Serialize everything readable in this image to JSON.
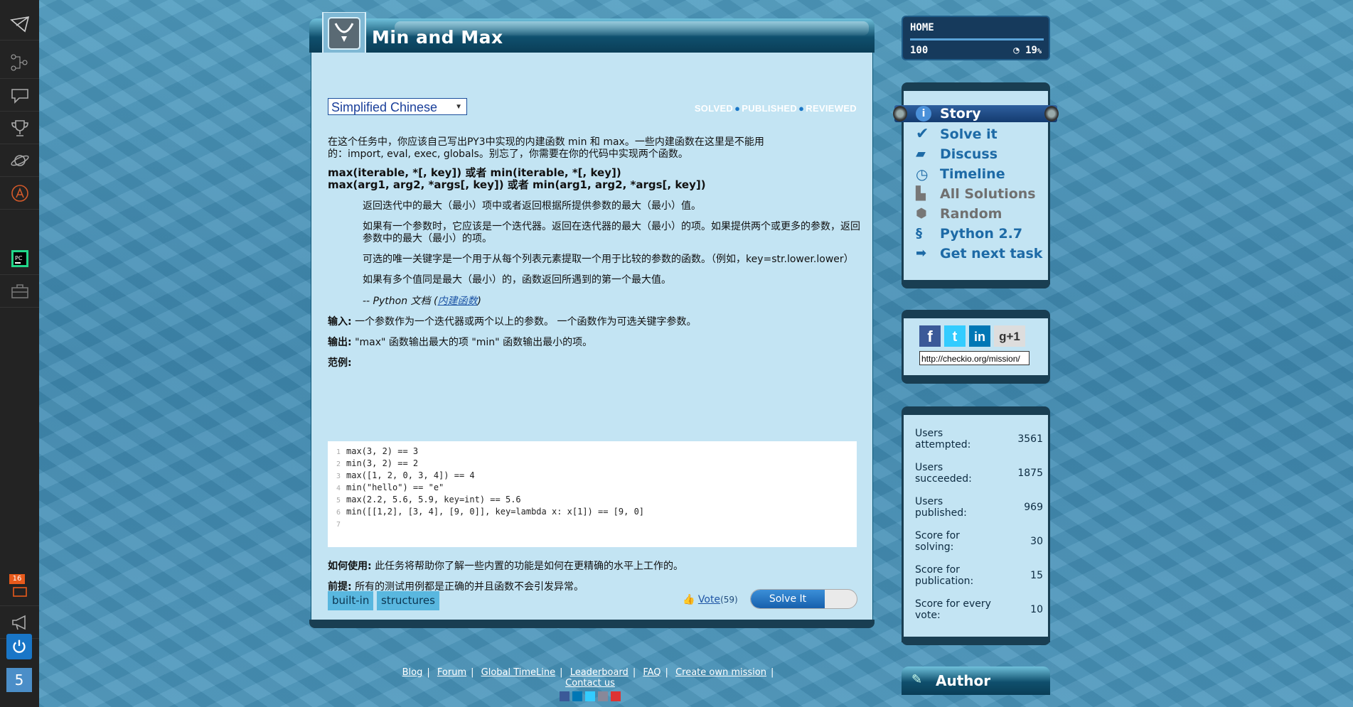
{
  "sidebar": {
    "icons": [
      "mail-icon",
      "tree-icon",
      "chat-icon",
      "trophy-icon",
      "planet-icon",
      "language-icon",
      "pycharm-icon",
      "briefcase-icon"
    ],
    "notification_count": "16",
    "level": "5"
  },
  "mission": {
    "title": "Min and Max",
    "language_selected": "Simplified Chinese",
    "status": {
      "solved": "SOLVED",
      "published": "PUBLISHED",
      "reviewed": "REVIEWED"
    },
    "intro_1": "在这个任务中，你应该自己写出PY3中实现的内建函数 min 和 max。一些内建函数在这里是不能用",
    "intro_2": "的：import, eval, exec, globals。别忘了，你需要在你的代码中实现两个函数。",
    "sig_1": "max(iterable, *[, key]) 或者 min(iterable, *[, key])",
    "sig_2": "max(arg1, arg2, *args[, key]) 或者 min(arg1, arg2, *args[, key])",
    "desc_1": "返回迭代中的最大（最小）项中或者返回根据所提供参数的最大（最小）值。",
    "desc_2a": "如果有一个参数时，它应该是一个迭代器。返回在迭代器的最大（最小）的项。如果提供两个或更多的参数，返回",
    "desc_2b": "参数中的最大（最小）的项。",
    "desc_3": "可选的唯一关键字是一个用于从每个列表元素提取一个用于比较的参数的函数。（例如，key=str.lower.lower）",
    "desc_4": "如果有多个值同是最大（最小）的，函数返回所遇到的第一个最大值。",
    "doc_prefix": "-- Python 文档 (",
    "doc_link": "内建函数",
    "doc_suffix": ")",
    "input_label": "输入:",
    "input_text": "一个参数作为一个迭代器或两个以上的参数。   一个函数作为可选关键字参数。",
    "output_label": "输出:",
    "output_text": "\"max\" 函数输出最大的项 \"min\" 函数输出最小的项。",
    "example_label": "范例:",
    "code_lines": [
      {
        "n": "1",
        "text": "max(3, 2) == 3"
      },
      {
        "n": "2",
        "text": "min(3, 2) == 2"
      },
      {
        "n": "3",
        "text": "max([1, 2, 0, 3, 4]) == 4"
      },
      {
        "n": "4",
        "text": "min(\"hello\") == \"e\""
      },
      {
        "n": "5",
        "text": "max(2.2, 5.6, 5.9, key=int) == 5.6"
      },
      {
        "n": "6",
        "text": "min([[1,2], [3, 4], [9, 0]], key=lambda x: x[1]) == [9, 0]"
      },
      {
        "n": "7",
        "text": ""
      }
    ],
    "howto_label": "如何使用:",
    "howto_text": "此任务将帮助你了解一些内置的功能是如何在更精确的水平上工作的。",
    "precond_label": "前提:",
    "precond_text": "所有的测试用例都是正确的并且函数不会引发异常。",
    "tags": [
      "built-in",
      "structures"
    ],
    "vote_label": "Vote",
    "vote_count": "(59)",
    "solve_button": "Solve It"
  },
  "home_widget": {
    "title": "HOME",
    "points": "100",
    "progress": "19",
    "progress_unit": "%"
  },
  "mission_menu": [
    {
      "label": "Story",
      "icon": "info-icon",
      "active": true
    },
    {
      "label": "Solve it",
      "icon": "check-icon"
    },
    {
      "label": "Discuss",
      "icon": "discuss-icon"
    },
    {
      "label": "Timeline",
      "icon": "clock-icon"
    },
    {
      "label": "All Solutions",
      "icon": "solutions-icon",
      "muted": true
    },
    {
      "label": "Random",
      "icon": "dice-icon",
      "muted": true
    },
    {
      "label": "Python 2.7",
      "icon": "python-icon"
    },
    {
      "label": "Get next task",
      "icon": "arrow-icon"
    }
  ],
  "share": {
    "url": "http://checkio.org/mission/"
  },
  "stats": [
    {
      "label": "Users attempted:",
      "value": "3561"
    },
    {
      "label": "Users succeeded:",
      "value": "1875"
    },
    {
      "label": "Users published:",
      "value": "969"
    },
    {
      "label": "Score for solving:",
      "value": "30"
    },
    {
      "label": "Score for publication:",
      "value": "15"
    },
    {
      "label": "Score for every vote:",
      "value": "10"
    }
  ],
  "author_title": "Author",
  "footer": {
    "links": [
      "Blog",
      "Forum",
      "Global TimeLine",
      "Leaderboard",
      "FAQ",
      "Create own mission",
      "Contact us"
    ]
  }
}
